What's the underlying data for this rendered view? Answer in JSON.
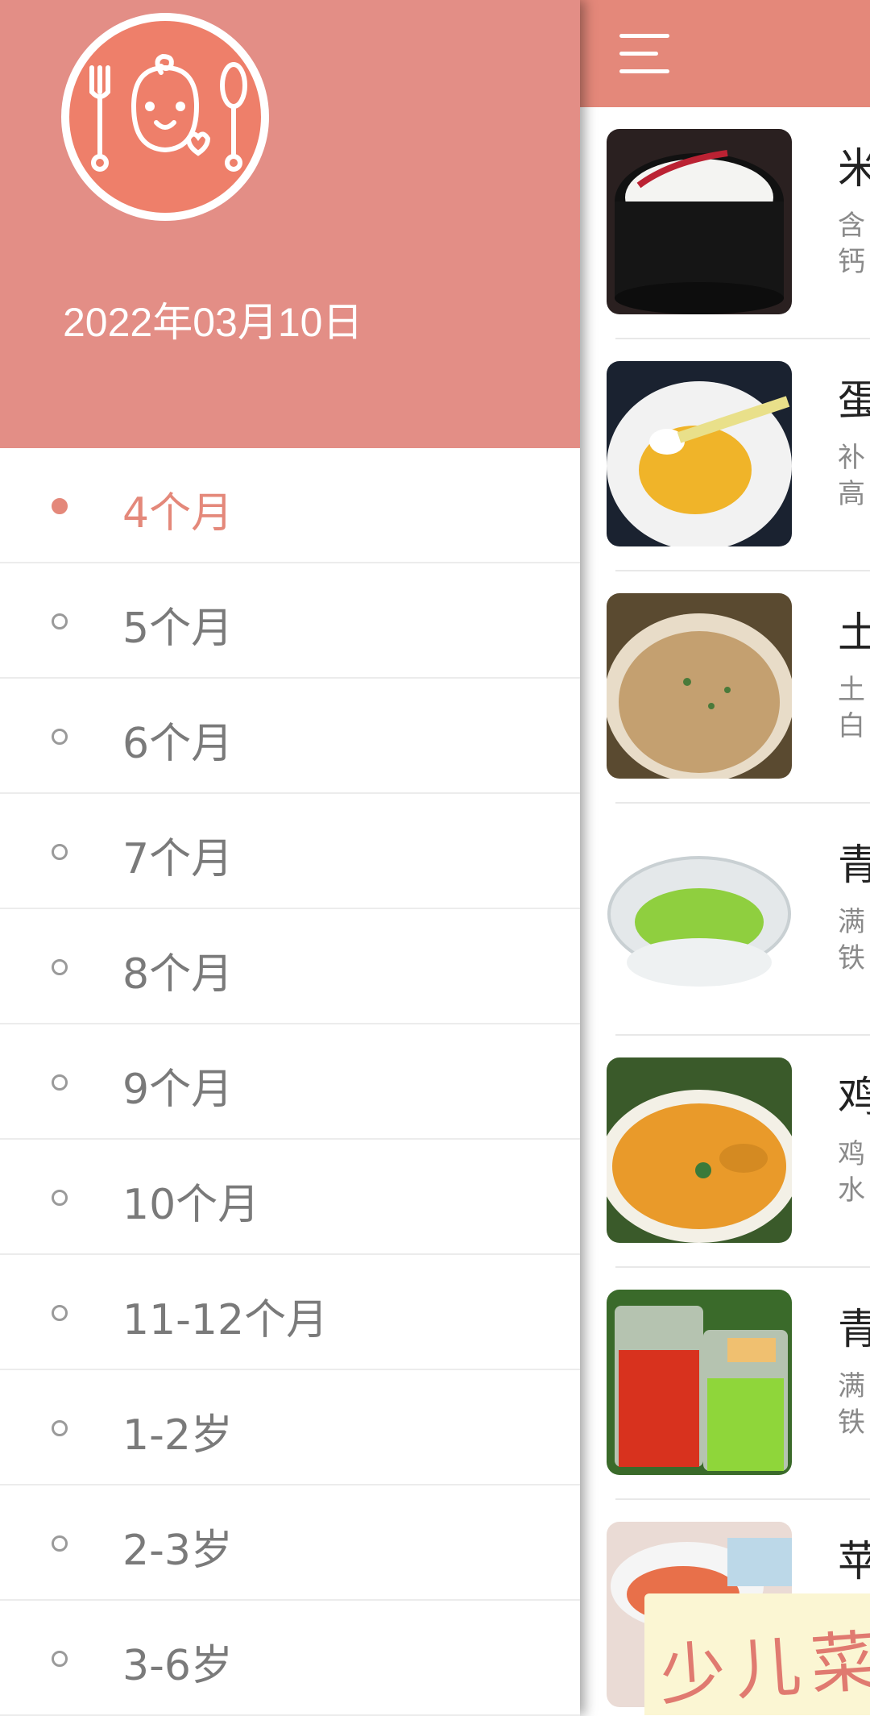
{
  "drawer": {
    "date": "2022年03月10日",
    "age_items": [
      {
        "label": "4个月",
        "selected": true
      },
      {
        "label": "5个月",
        "selected": false
      },
      {
        "label": "6个月",
        "selected": false
      },
      {
        "label": "7个月",
        "selected": false
      },
      {
        "label": "8个月",
        "selected": false
      },
      {
        "label": "9个月",
        "selected": false
      },
      {
        "label": "10个月",
        "selected": false
      },
      {
        "label": "11-12个月",
        "selected": false
      },
      {
        "label": "1-2岁",
        "selected": false
      },
      {
        "label": "2-3岁",
        "selected": false
      },
      {
        "label": "3-6岁",
        "selected": false
      }
    ]
  },
  "main": {
    "recipes": [
      {
        "name": "米",
        "desc_lines": [
          "含",
          "钙"
        ],
        "image": "rice-porridge-image"
      },
      {
        "name": "蛋",
        "desc_lines": [
          "补",
          "高"
        ],
        "image": "egg-yolk-image"
      },
      {
        "name": "土",
        "desc_lines": [
          "土",
          "白"
        ],
        "image": "mashed-potato-image"
      },
      {
        "name": "青",
        "desc_lines": [
          "满",
          "铁"
        ],
        "image": "green-puree-image"
      },
      {
        "name": "鸡",
        "desc_lines": [
          "鸡",
          "水"
        ],
        "image": "soup-image"
      },
      {
        "name": "青",
        "desc_lines": [
          "满",
          "铁"
        ],
        "image": "juice-image"
      },
      {
        "name": "苹",
        "desc_lines": [
          "",
          ""
        ],
        "image": "carrot-puree-image"
      }
    ],
    "watermark": "少儿菜"
  },
  "colors": {
    "accent": "#e4887a",
    "drawer_header": "#e38e86",
    "text_muted": "#7a7a7a"
  }
}
